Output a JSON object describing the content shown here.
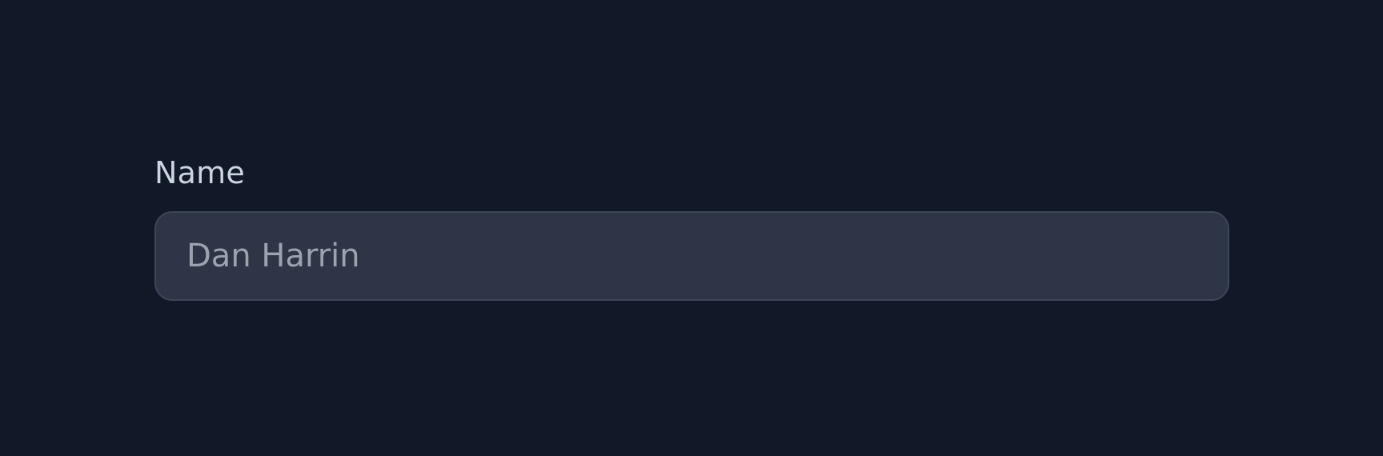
{
  "form": {
    "name_field": {
      "label": "Name",
      "value": "Dan Harrin",
      "disabled": true
    }
  },
  "colors": {
    "background": "#111827",
    "label_text": "#cbd5e1",
    "input_background": "#2d3546",
    "input_border": "#3d475a",
    "input_text": "#9ca3af"
  }
}
